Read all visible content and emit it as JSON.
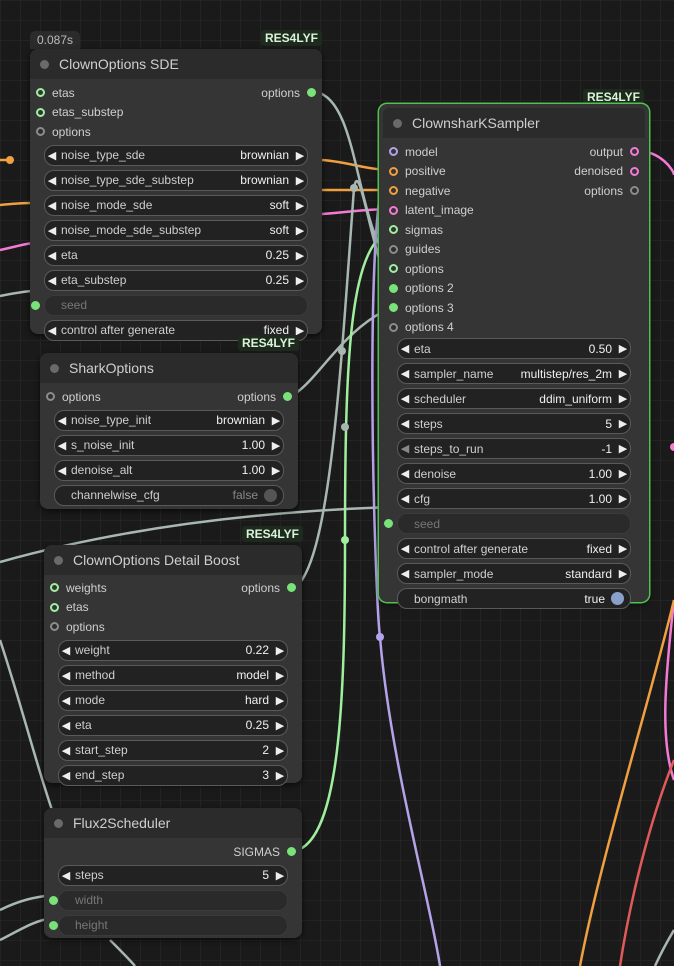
{
  "colors": {
    "model": "#b4a3e8",
    "conditioning": "#f0a040",
    "latent": "#f47ad6",
    "sigmas": "#9fef9f",
    "options": "#a8b8b0",
    "selected_border": "#4ec24e"
  },
  "clown_sde": {
    "timing": "0.087s",
    "tag": "RES4LYF",
    "title": "ClownOptions SDE",
    "inputs": [
      "etas",
      "etas_substep",
      "options"
    ],
    "output": "options",
    "widgets": [
      {
        "label": "noise_type_sde",
        "value": "brownian"
      },
      {
        "label": "noise_type_sde_substep",
        "value": "brownian"
      },
      {
        "label": "noise_mode_sde",
        "value": "soft"
      },
      {
        "label": "noise_mode_sde_substep",
        "value": "soft"
      },
      {
        "label": "eta",
        "value": "0.25"
      },
      {
        "label": "eta_substep",
        "value": "0.25"
      }
    ],
    "seed_label": "seed",
    "control": {
      "label": "control after generate",
      "value": "fixed"
    }
  },
  "shark_options": {
    "tag": "RES4LYF",
    "title": "SharkOptions",
    "input": "options",
    "output": "options",
    "widgets": [
      {
        "label": "noise_type_init",
        "value": "brownian"
      },
      {
        "label": "s_noise_init",
        "value": "1.00"
      },
      {
        "label": "denoise_alt",
        "value": "1.00"
      }
    ],
    "toggle": {
      "label": "channelwise_cfg",
      "value": "false"
    }
  },
  "detail_boost": {
    "tag": "RES4LYF",
    "title": "ClownOptions Detail Boost",
    "inputs": [
      "weights",
      "etas",
      "options"
    ],
    "output": "options",
    "widgets": [
      {
        "label": "weight",
        "value": "0.22"
      },
      {
        "label": "method",
        "value": "model"
      },
      {
        "label": "mode",
        "value": "hard"
      },
      {
        "label": "eta",
        "value": "0.25"
      },
      {
        "label": "start_step",
        "value": "2"
      },
      {
        "label": "end_step",
        "value": "3"
      }
    ]
  },
  "flux_scheduler": {
    "title": "Flux2Scheduler",
    "output": "SIGMAS",
    "widgets": [
      {
        "label": "steps",
        "value": "5"
      }
    ],
    "dim_inputs": [
      "width",
      "height"
    ]
  },
  "sampler": {
    "tag": "RES4LYF",
    "title": "ClownsharKSampler",
    "inputs": [
      "model",
      "positive",
      "negative",
      "latent_image",
      "sigmas",
      "guides",
      "options",
      "options 2",
      "options 3",
      "options 4"
    ],
    "outputs": [
      "output",
      "denoised",
      "options"
    ],
    "widgets": [
      {
        "label": "eta",
        "value": "0.50"
      },
      {
        "label": "sampler_name",
        "value": "multistep/res_2m"
      },
      {
        "label": "scheduler",
        "value": "ddim_uniform"
      },
      {
        "label": "steps",
        "value": "5"
      },
      {
        "label": "steps_to_run",
        "value": "-1"
      },
      {
        "label": "denoise",
        "value": "1.00"
      },
      {
        "label": "cfg",
        "value": "1.00"
      }
    ],
    "seed_label": "seed",
    "widgets2": [
      {
        "label": "control after generate",
        "value": "fixed"
      },
      {
        "label": "sampler_mode",
        "value": "standard"
      }
    ],
    "toggle": {
      "label": "bongmath",
      "value": "true"
    }
  }
}
